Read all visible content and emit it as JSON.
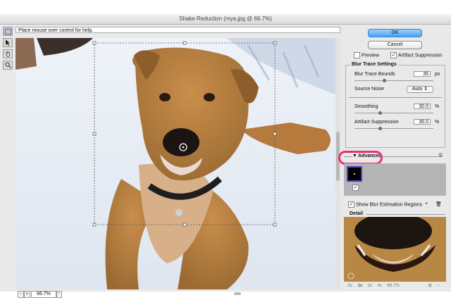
{
  "window": {
    "title": "Shake Reduction (mya.jpg @ 66.7%)"
  },
  "tools": [
    {
      "name": "blur-trace-tool-icon"
    },
    {
      "name": "pointer-tool-icon"
    },
    {
      "name": "hand-tool-icon"
    },
    {
      "name": "zoom-tool-icon"
    }
  ],
  "help_text": "Place mouse over control for help.",
  "buttons": {
    "ok": "OK",
    "cancel": "Cancel"
  },
  "options": {
    "preview": "Preview",
    "preview_checked": false,
    "artifact_suppression": "Artifact Suppression",
    "artifact_suppression_checked": true
  },
  "blur_trace": {
    "title": "Blur Trace Settings",
    "bounds_label": "Blur Trace Bounds",
    "bounds_value": "35",
    "bounds_unit": "px",
    "noise_label": "Source Noise",
    "noise_value": "Auto",
    "smoothing_label": "Smoothing",
    "smoothing_value": "30.0",
    "smoothing_unit": "%",
    "artifact_label": "Artifact Suppression",
    "artifact_value": "30.0",
    "artifact_unit": "%"
  },
  "advanced": {
    "label": "Advanced",
    "show_regions": "Show Blur Estimation Regions",
    "show_regions_checked": true
  },
  "detail": {
    "label": "Detail",
    "zoom_options": [
      ".5x",
      "1x",
      "2x",
      "4x"
    ],
    "zoom_selected": "1x",
    "zoom_readout": "66.7%"
  },
  "status": {
    "zoom": "66.7%"
  },
  "colors": {
    "accent": "#4aa2f2",
    "highlight": "#e8307a",
    "trace_border": "#4e3ad2"
  }
}
